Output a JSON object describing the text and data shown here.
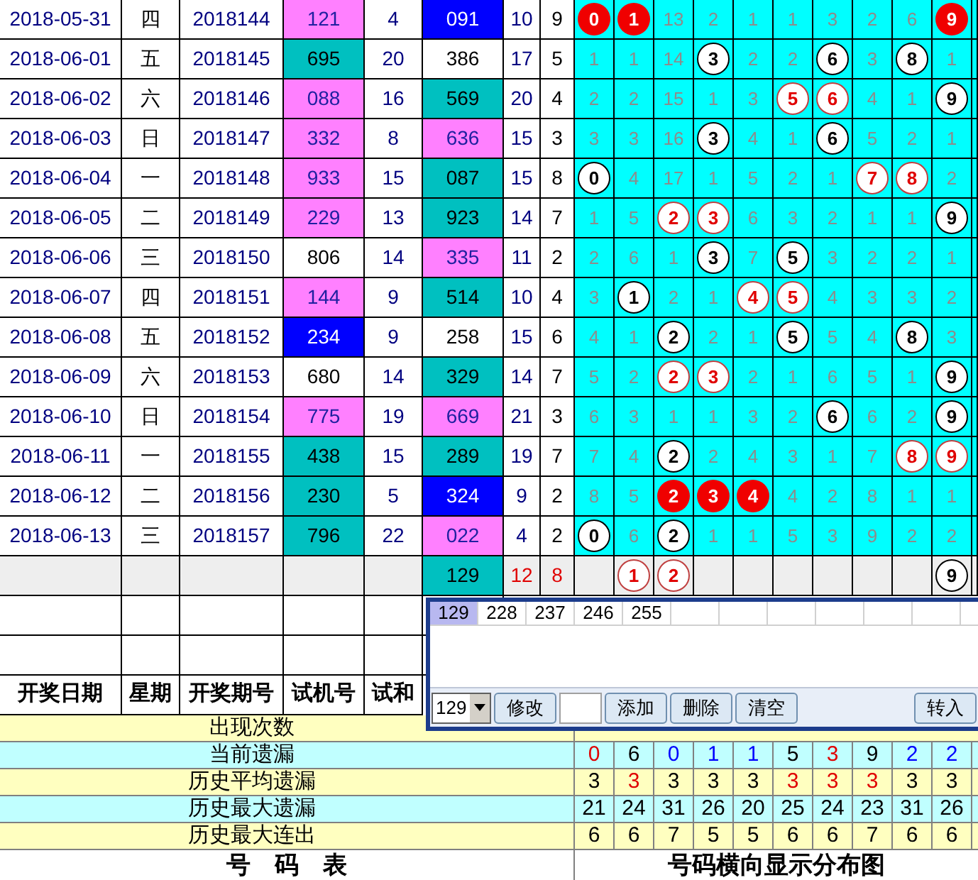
{
  "draws": [
    {
      "date": "2018-05-31",
      "weekday": "四",
      "issue": "2018144",
      "trial": {
        "text": "121",
        "color": "#ff80ff"
      },
      "trial_sum": "4",
      "draw": {
        "text": "091",
        "color": "#0000ff"
      },
      "sum": "10",
      "span": "9",
      "digits": [
        {
          "kind": "solid",
          "text": "0"
        },
        {
          "kind": "solid",
          "text": "1"
        },
        {
          "kind": "miss",
          "text": "13"
        },
        {
          "kind": "miss",
          "text": "2"
        },
        {
          "kind": "miss",
          "text": "1"
        },
        {
          "kind": "miss",
          "text": "1"
        },
        {
          "kind": "miss",
          "text": "3"
        },
        {
          "kind": "miss",
          "text": "2"
        },
        {
          "kind": "miss",
          "text": "6"
        },
        {
          "kind": "solid",
          "text": "9"
        }
      ]
    },
    {
      "date": "2018-06-01",
      "weekday": "五",
      "issue": "2018145",
      "trial": {
        "text": "695",
        "color": "#00c0c0"
      },
      "trial_sum": "20",
      "draw": {
        "text": "386",
        "color": "#ffffff"
      },
      "sum": "17",
      "span": "5",
      "digits": [
        {
          "kind": "miss",
          "text": "1"
        },
        {
          "kind": "miss",
          "text": "1"
        },
        {
          "kind": "miss",
          "text": "14"
        },
        {
          "kind": "plain",
          "text": "3"
        },
        {
          "kind": "miss",
          "text": "2"
        },
        {
          "kind": "miss",
          "text": "2"
        },
        {
          "kind": "plain",
          "text": "6"
        },
        {
          "kind": "miss",
          "text": "3"
        },
        {
          "kind": "plain",
          "text": "8"
        },
        {
          "kind": "miss",
          "text": "1"
        }
      ]
    },
    {
      "date": "2018-06-02",
      "weekday": "六",
      "issue": "2018146",
      "trial": {
        "text": "088",
        "color": "#ff80ff"
      },
      "trial_sum": "16",
      "draw": {
        "text": "569",
        "color": "#00c0c0"
      },
      "sum": "20",
      "span": "4",
      "digits": [
        {
          "kind": "miss",
          "text": "2"
        },
        {
          "kind": "miss",
          "text": "2"
        },
        {
          "kind": "miss",
          "text": "15"
        },
        {
          "kind": "miss",
          "text": "1"
        },
        {
          "kind": "miss",
          "text": "3"
        },
        {
          "kind": "red",
          "text": "5"
        },
        {
          "kind": "red",
          "text": "6"
        },
        {
          "kind": "miss",
          "text": "4"
        },
        {
          "kind": "miss",
          "text": "1"
        },
        {
          "kind": "plain",
          "text": "9"
        }
      ]
    },
    {
      "date": "2018-06-03",
      "weekday": "日",
      "issue": "2018147",
      "trial": {
        "text": "332",
        "color": "#ff80ff"
      },
      "trial_sum": "8",
      "draw": {
        "text": "636",
        "color": "#ff80ff"
      },
      "sum": "15",
      "span": "3",
      "digits": [
        {
          "kind": "miss",
          "text": "3"
        },
        {
          "kind": "miss",
          "text": "3"
        },
        {
          "kind": "miss",
          "text": "16"
        },
        {
          "kind": "plain",
          "text": "3"
        },
        {
          "kind": "miss",
          "text": "4"
        },
        {
          "kind": "miss",
          "text": "1"
        },
        {
          "kind": "plain",
          "text": "6"
        },
        {
          "kind": "miss",
          "text": "5"
        },
        {
          "kind": "miss",
          "text": "2"
        },
        {
          "kind": "miss",
          "text": "1"
        }
      ]
    },
    {
      "date": "2018-06-04",
      "weekday": "一",
      "issue": "2018148",
      "trial": {
        "text": "933",
        "color": "#ff80ff"
      },
      "trial_sum": "15",
      "draw": {
        "text": "087",
        "color": "#00c0c0"
      },
      "sum": "15",
      "span": "8",
      "digits": [
        {
          "kind": "plain",
          "text": "0"
        },
        {
          "kind": "miss",
          "text": "4"
        },
        {
          "kind": "miss",
          "text": "17"
        },
        {
          "kind": "miss",
          "text": "1"
        },
        {
          "kind": "miss",
          "text": "5"
        },
        {
          "kind": "miss",
          "text": "2"
        },
        {
          "kind": "miss",
          "text": "1"
        },
        {
          "kind": "red",
          "text": "7"
        },
        {
          "kind": "red",
          "text": "8"
        },
        {
          "kind": "miss",
          "text": "2"
        }
      ]
    },
    {
      "date": "2018-06-05",
      "weekday": "二",
      "issue": "2018149",
      "trial": {
        "text": "229",
        "color": "#ff80ff"
      },
      "trial_sum": "13",
      "draw": {
        "text": "923",
        "color": "#00c0c0"
      },
      "sum": "14",
      "span": "7",
      "digits": [
        {
          "kind": "miss",
          "text": "1"
        },
        {
          "kind": "miss",
          "text": "5"
        },
        {
          "kind": "red",
          "text": "2"
        },
        {
          "kind": "red",
          "text": "3"
        },
        {
          "kind": "miss",
          "text": "6"
        },
        {
          "kind": "miss",
          "text": "3"
        },
        {
          "kind": "miss",
          "text": "2"
        },
        {
          "kind": "miss",
          "text": "1"
        },
        {
          "kind": "miss",
          "text": "1"
        },
        {
          "kind": "plain",
          "text": "9"
        }
      ]
    },
    {
      "date": "2018-06-06",
      "weekday": "三",
      "issue": "2018150",
      "trial": {
        "text": "806",
        "color": "#ffffff"
      },
      "trial_sum": "14",
      "draw": {
        "text": "335",
        "color": "#ff80ff"
      },
      "sum": "11",
      "span": "2",
      "digits": [
        {
          "kind": "miss",
          "text": "2"
        },
        {
          "kind": "miss",
          "text": "6"
        },
        {
          "kind": "miss",
          "text": "1"
        },
        {
          "kind": "plain",
          "text": "3"
        },
        {
          "kind": "miss",
          "text": "7"
        },
        {
          "kind": "plain",
          "text": "5"
        },
        {
          "kind": "miss",
          "text": "3"
        },
        {
          "kind": "miss",
          "text": "2"
        },
        {
          "kind": "miss",
          "text": "2"
        },
        {
          "kind": "miss",
          "text": "1"
        }
      ]
    },
    {
      "date": "2018-06-07",
      "weekday": "四",
      "issue": "2018151",
      "trial": {
        "text": "144",
        "color": "#ff80ff"
      },
      "trial_sum": "9",
      "draw": {
        "text": "514",
        "color": "#00c0c0"
      },
      "sum": "10",
      "span": "4",
      "digits": [
        {
          "kind": "miss",
          "text": "3"
        },
        {
          "kind": "plain",
          "text": "1"
        },
        {
          "kind": "miss",
          "text": "2"
        },
        {
          "kind": "miss",
          "text": "1"
        },
        {
          "kind": "red",
          "text": "4"
        },
        {
          "kind": "red",
          "text": "5"
        },
        {
          "kind": "miss",
          "text": "4"
        },
        {
          "kind": "miss",
          "text": "3"
        },
        {
          "kind": "miss",
          "text": "3"
        },
        {
          "kind": "miss",
          "text": "2"
        }
      ]
    },
    {
      "date": "2018-06-08",
      "weekday": "五",
      "issue": "2018152",
      "trial": {
        "text": "234",
        "color": "#0000ff"
      },
      "trial_sum": "9",
      "draw": {
        "text": "258",
        "color": "#ffffff"
      },
      "sum": "15",
      "span": "6",
      "digits": [
        {
          "kind": "miss",
          "text": "4"
        },
        {
          "kind": "miss",
          "text": "1"
        },
        {
          "kind": "plain",
          "text": "2"
        },
        {
          "kind": "miss",
          "text": "2"
        },
        {
          "kind": "miss",
          "text": "1"
        },
        {
          "kind": "plain",
          "text": "5"
        },
        {
          "kind": "miss",
          "text": "5"
        },
        {
          "kind": "miss",
          "text": "4"
        },
        {
          "kind": "plain",
          "text": "8"
        },
        {
          "kind": "miss",
          "text": "3"
        }
      ]
    },
    {
      "date": "2018-06-09",
      "weekday": "六",
      "issue": "2018153",
      "trial": {
        "text": "680",
        "color": "#ffffff"
      },
      "trial_sum": "14",
      "draw": {
        "text": "329",
        "color": "#00c0c0"
      },
      "sum": "14",
      "span": "7",
      "digits": [
        {
          "kind": "miss",
          "text": "5"
        },
        {
          "kind": "miss",
          "text": "2"
        },
        {
          "kind": "red",
          "text": "2"
        },
        {
          "kind": "red",
          "text": "3"
        },
        {
          "kind": "miss",
          "text": "2"
        },
        {
          "kind": "miss",
          "text": "1"
        },
        {
          "kind": "miss",
          "text": "6"
        },
        {
          "kind": "miss",
          "text": "5"
        },
        {
          "kind": "miss",
          "text": "1"
        },
        {
          "kind": "plain",
          "text": "9"
        }
      ]
    },
    {
      "date": "2018-06-10",
      "weekday": "日",
      "issue": "2018154",
      "trial": {
        "text": "775",
        "color": "#ff80ff"
      },
      "trial_sum": "19",
      "draw": {
        "text": "669",
        "color": "#ff80ff"
      },
      "sum": "21",
      "span": "3",
      "digits": [
        {
          "kind": "miss",
          "text": "6"
        },
        {
          "kind": "miss",
          "text": "3"
        },
        {
          "kind": "miss",
          "text": "1"
        },
        {
          "kind": "miss",
          "text": "1"
        },
        {
          "kind": "miss",
          "text": "3"
        },
        {
          "kind": "miss",
          "text": "2"
        },
        {
          "kind": "plain",
          "text": "6"
        },
        {
          "kind": "miss",
          "text": "6"
        },
        {
          "kind": "miss",
          "text": "2"
        },
        {
          "kind": "plain",
          "text": "9"
        }
      ]
    },
    {
      "date": "2018-06-11",
      "weekday": "一",
      "issue": "2018155",
      "trial": {
        "text": "438",
        "color": "#00c0c0"
      },
      "trial_sum": "15",
      "draw": {
        "text": "289",
        "color": "#00c0c0"
      },
      "sum": "19",
      "span": "7",
      "digits": [
        {
          "kind": "miss",
          "text": "7"
        },
        {
          "kind": "miss",
          "text": "4"
        },
        {
          "kind": "plain",
          "text": "2"
        },
        {
          "kind": "miss",
          "text": "2"
        },
        {
          "kind": "miss",
          "text": "4"
        },
        {
          "kind": "miss",
          "text": "3"
        },
        {
          "kind": "miss",
          "text": "1"
        },
        {
          "kind": "miss",
          "text": "7"
        },
        {
          "kind": "red",
          "text": "8"
        },
        {
          "kind": "red",
          "text": "9"
        }
      ]
    },
    {
      "date": "2018-06-12",
      "weekday": "二",
      "issue": "2018156",
      "trial": {
        "text": "230",
        "color": "#00c0c0"
      },
      "trial_sum": "5",
      "draw": {
        "text": "324",
        "color": "#0000ff"
      },
      "sum": "9",
      "span": "2",
      "digits": [
        {
          "kind": "miss",
          "text": "8"
        },
        {
          "kind": "miss",
          "text": "5"
        },
        {
          "kind": "solid",
          "text": "2"
        },
        {
          "kind": "solid",
          "text": "3"
        },
        {
          "kind": "solid",
          "text": "4"
        },
        {
          "kind": "miss",
          "text": "4"
        },
        {
          "kind": "miss",
          "text": "2"
        },
        {
          "kind": "miss",
          "text": "8"
        },
        {
          "kind": "miss",
          "text": "1"
        },
        {
          "kind": "miss",
          "text": "1"
        }
      ]
    },
    {
      "date": "2018-06-13",
      "weekday": "三",
      "issue": "2018157",
      "trial": {
        "text": "796",
        "color": "#00c0c0"
      },
      "trial_sum": "22",
      "draw": {
        "text": "022",
        "color": "#ff80ff"
      },
      "sum": "4",
      "span": "2",
      "digits": [
        {
          "kind": "plain",
          "text": "0"
        },
        {
          "kind": "miss",
          "text": "6"
        },
        {
          "kind": "plain",
          "text": "2"
        },
        {
          "kind": "miss",
          "text": "1"
        },
        {
          "kind": "miss",
          "text": "1"
        },
        {
          "kind": "miss",
          "text": "5"
        },
        {
          "kind": "miss",
          "text": "3"
        },
        {
          "kind": "miss",
          "text": "9"
        },
        {
          "kind": "miss",
          "text": "2"
        },
        {
          "kind": "miss",
          "text": "2"
        }
      ]
    }
  ],
  "pending": {
    "draw": {
      "text": "129",
      "color": "#00c0c0"
    },
    "sum": "12",
    "span": "8",
    "digits": [
      {
        "kind": "empty"
      },
      {
        "kind": "red",
        "text": "1"
      },
      {
        "kind": "red",
        "text": "2"
      },
      {
        "kind": "empty"
      },
      {
        "kind": "empty"
      },
      {
        "kind": "empty"
      },
      {
        "kind": "empty"
      },
      {
        "kind": "empty"
      },
      {
        "kind": "empty"
      },
      {
        "kind": "plain",
        "text": "9"
      }
    ]
  },
  "headers": [
    "开奖日期",
    "星期",
    "开奖期号",
    "试机号",
    "试和"
  ],
  "statistics": [
    {
      "label": "出现次数"
    },
    {
      "label": "当前遗漏",
      "values": [
        {
          "text": "0",
          "color": "#e00000"
        },
        {
          "text": "6",
          "color": "#000000"
        },
        {
          "text": "0",
          "color": "#0000ff"
        },
        {
          "text": "1",
          "color": "#0000ff"
        },
        {
          "text": "1",
          "color": "#0000ff"
        },
        {
          "text": "5",
          "color": "#000000"
        },
        {
          "text": "3",
          "color": "#e00000"
        },
        {
          "text": "9",
          "color": "#000000"
        },
        {
          "text": "2",
          "color": "#0000ff"
        },
        {
          "text": "2",
          "color": "#0000ff"
        }
      ]
    },
    {
      "label": "历史平均遗漏",
      "values": [
        {
          "text": "3",
          "color": "#000000"
        },
        {
          "text": "3",
          "color": "#e00000"
        },
        {
          "text": "3",
          "color": "#000000"
        },
        {
          "text": "3",
          "color": "#000000"
        },
        {
          "text": "3",
          "color": "#000000"
        },
        {
          "text": "3",
          "color": "#e00000"
        },
        {
          "text": "3",
          "color": "#e00000"
        },
        {
          "text": "3",
          "color": "#e00000"
        },
        {
          "text": "3",
          "color": "#000000"
        },
        {
          "text": "3",
          "color": "#000000"
        }
      ]
    },
    {
      "label": "历史最大遗漏",
      "values": [
        {
          "text": "21",
          "color": "#000000"
        },
        {
          "text": "24",
          "color": "#000000"
        },
        {
          "text": "31",
          "color": "#000000"
        },
        {
          "text": "26",
          "color": "#000000"
        },
        {
          "text": "20",
          "color": "#000000"
        },
        {
          "text": "25",
          "color": "#000000"
        },
        {
          "text": "24",
          "color": "#000000"
        },
        {
          "text": "23",
          "color": "#000000"
        },
        {
          "text": "31",
          "color": "#000000"
        },
        {
          "text": "26",
          "color": "#000000"
        }
      ]
    },
    {
      "label": "历史最大连出",
      "values": [
        {
          "text": "6",
          "color": "#000000"
        },
        {
          "text": "6",
          "color": "#000000"
        },
        {
          "text": "7",
          "color": "#000000"
        },
        {
          "text": "5",
          "color": "#000000"
        },
        {
          "text": "5",
          "color": "#000000"
        },
        {
          "text": "6",
          "color": "#000000"
        },
        {
          "text": "6",
          "color": "#000000"
        },
        {
          "text": "7",
          "color": "#000000"
        },
        {
          "text": "6",
          "color": "#000000"
        },
        {
          "text": "6",
          "color": "#000000"
        }
      ]
    }
  ],
  "footer": {
    "left": "号　码　表",
    "right": "号码横向显示分布图"
  },
  "popup": {
    "list": [
      {
        "text": "129",
        "selected": true
      },
      {
        "text": "228",
        "selected": false
      },
      {
        "text": "237",
        "selected": false
      },
      {
        "text": "246",
        "selected": false
      },
      {
        "text": "255",
        "selected": false
      }
    ],
    "toolbar": [
      {
        "kind": "combo",
        "value": "129"
      },
      {
        "kind": "button",
        "label": "修改"
      },
      {
        "kind": "input"
      },
      {
        "kind": "button",
        "label": "添加"
      },
      {
        "kind": "button",
        "label": "删除"
      },
      {
        "kind": "button",
        "label": "清空"
      },
      {
        "kind": "spacer"
      },
      {
        "kind": "button",
        "label": "转入"
      }
    ]
  }
}
